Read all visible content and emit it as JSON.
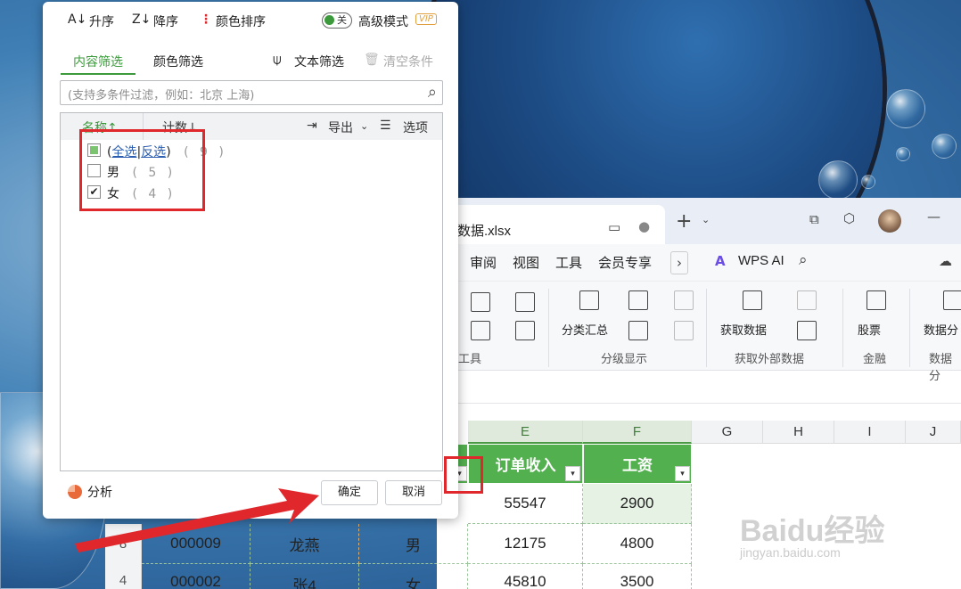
{
  "window": {
    "doc_tab_title": "数据.xlsx",
    "menu": [
      "审阅",
      "视图",
      "工具",
      "会员专享"
    ],
    "wps_ai_label": "WPS AI",
    "ribbon": {
      "group_tools_label": "工具",
      "subtotal_label": "分类汇总",
      "group_outline_label": "分级显示",
      "get_data_label": "获取数据",
      "group_external_label": "获取外部数据",
      "stocks_label": "股票",
      "group_finance_label": "金融",
      "data_label": "数据分",
      "data_group_label": "数据分"
    }
  },
  "sheet": {
    "columns": [
      "E",
      "F",
      "G",
      "H",
      "I",
      "J"
    ],
    "header_row": {
      "e": "订单收入",
      "f": "工资"
    },
    "rows": [
      {
        "row_no": "",
        "d": "",
        "e": "55547",
        "f": "2900"
      },
      {
        "row_no": "8",
        "a": "000009",
        "b": "龙燕",
        "c": "男",
        "e": "12175",
        "f": "4800"
      },
      {
        "row_no": "4",
        "a": "000002",
        "b": "张4",
        "c": "女",
        "e": "45810",
        "f": "3500"
      }
    ]
  },
  "filter_popup": {
    "sort_asc": "升序",
    "sort_desc": "降序",
    "color_sort": "颜色排序",
    "toggle_label": "关",
    "advanced_mode": "高级模式",
    "vip": "VIP",
    "tab_content": "内容筛选",
    "tab_color": "颜色筛选",
    "text_filter": "文本筛选",
    "clear_conditions": "清空条件",
    "search_placeholder": "(支持多条件过滤，例如：北京 上海)",
    "col_name": "名称",
    "col_count": "计数",
    "export": "导出",
    "options": "选项",
    "items": [
      {
        "label_open": "(",
        "select_all": "全选",
        "invert": "反选",
        "label_close": ")",
        "count": "( 9 )",
        "state": "partial"
      },
      {
        "label": "男",
        "count": "( 5 )",
        "state": "unchecked"
      },
      {
        "label": "女",
        "count": "( 4 )",
        "state": "checked"
      }
    ],
    "analysis": "分析",
    "ok": "确定",
    "cancel": "取消"
  },
  "watermark": {
    "brand": "Baidu经验",
    "url": "jingyan.baidu.com"
  },
  "colors": {
    "accent_green": "#3c9a3c",
    "header_green": "#52b04f",
    "annotation_red": "#e0282c"
  }
}
